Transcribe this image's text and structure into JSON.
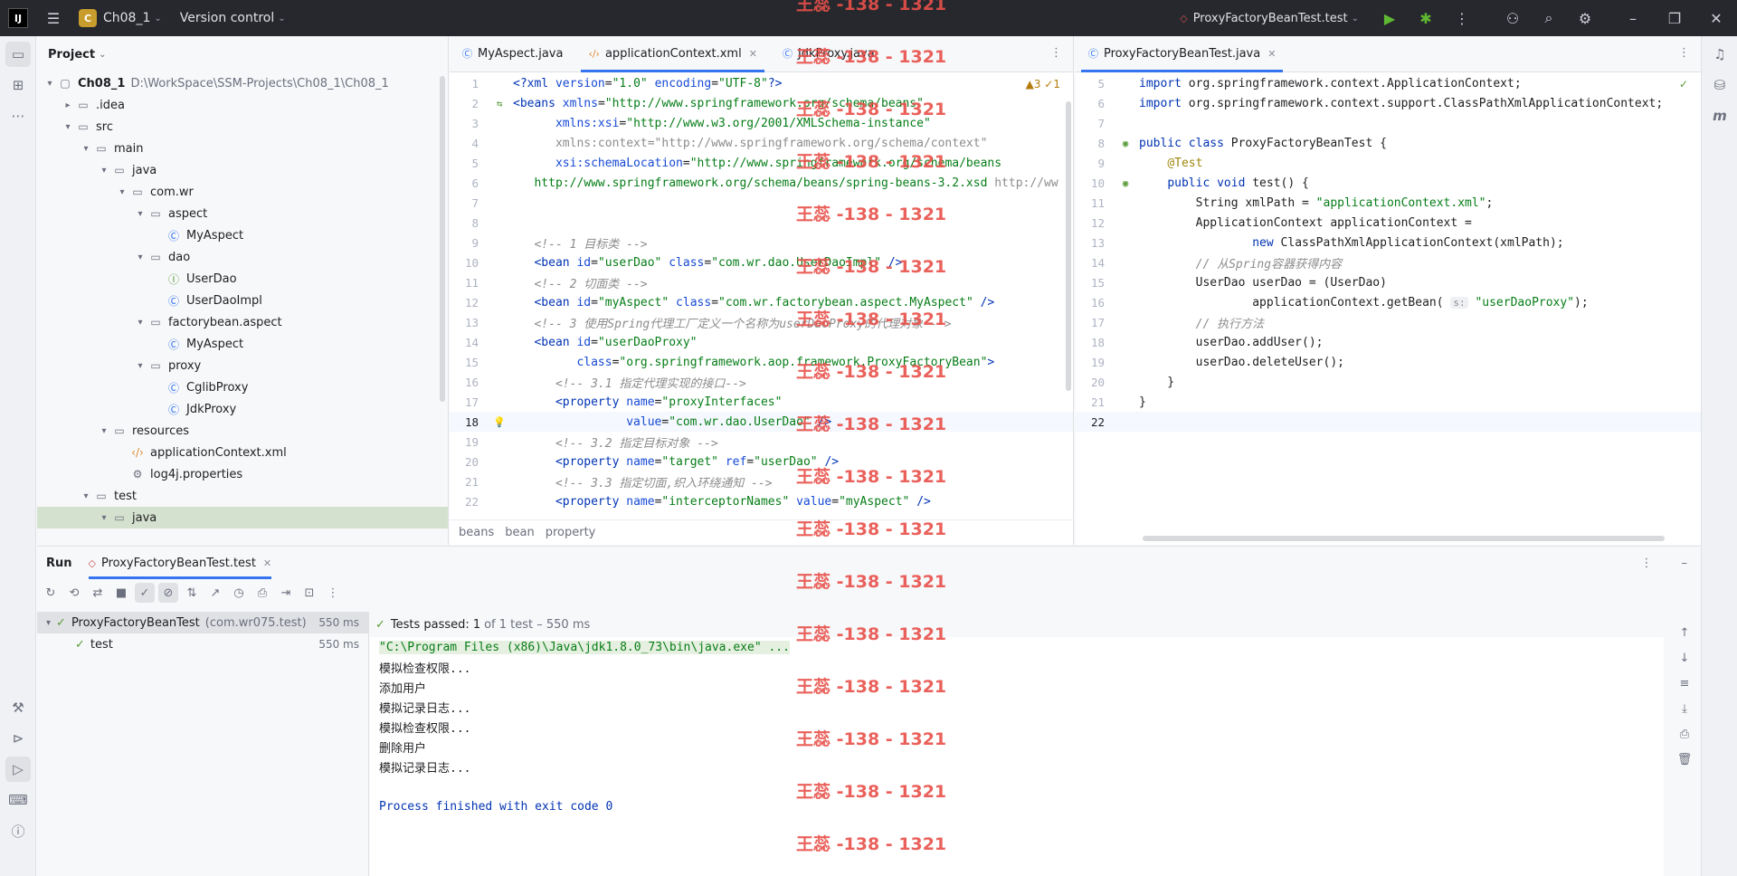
{
  "titlebar": {
    "project_badge": "C",
    "project_name": "Ch08_1",
    "vcs": "Version control",
    "run_config": "ProxyFactoryBeanTest.test"
  },
  "project_panel": {
    "title": "Project",
    "tree": [
      {
        "label": "Ch08_1",
        "path": "D:\\WorkSpace\\SSM-Projects\\Ch08_1\\Ch08_1",
        "depth": 0,
        "arrow": "▾",
        "icon": "▢"
      },
      {
        "label": ".idea",
        "depth": 1,
        "arrow": "▸",
        "icon": "▭"
      },
      {
        "label": "src",
        "depth": 1,
        "arrow": "▾",
        "icon": "▭"
      },
      {
        "label": "main",
        "depth": 2,
        "arrow": "▾",
        "icon": "▭"
      },
      {
        "label": "java",
        "depth": 3,
        "arrow": "▾",
        "icon": "▭"
      },
      {
        "label": "com.wr",
        "depth": 4,
        "arrow": "▾",
        "icon": "▭"
      },
      {
        "label": "aspect",
        "depth": 5,
        "arrow": "▾",
        "icon": "▭"
      },
      {
        "label": "MyAspect",
        "depth": 6,
        "arrow": "",
        "icon": "Ⓒ"
      },
      {
        "label": "dao",
        "depth": 5,
        "arrow": "▾",
        "icon": "▭"
      },
      {
        "label": "UserDao",
        "depth": 6,
        "arrow": "",
        "icon": "Ⓘ"
      },
      {
        "label": "UserDaoImpl",
        "depth": 6,
        "arrow": "",
        "icon": "Ⓒ"
      },
      {
        "label": "factorybean.aspect",
        "depth": 5,
        "arrow": "▾",
        "icon": "▭"
      },
      {
        "label": "MyAspect",
        "depth": 6,
        "arrow": "",
        "icon": "Ⓒ"
      },
      {
        "label": "proxy",
        "depth": 5,
        "arrow": "▾",
        "icon": "▭"
      },
      {
        "label": "CglibProxy",
        "depth": 6,
        "arrow": "",
        "icon": "Ⓒ"
      },
      {
        "label": "JdkProxy",
        "depth": 6,
        "arrow": "",
        "icon": "Ⓒ"
      },
      {
        "label": "resources",
        "depth": 3,
        "arrow": "▾",
        "icon": "▭"
      },
      {
        "label": "applicationContext.xml",
        "depth": 4,
        "arrow": "",
        "icon": "‹/›"
      },
      {
        "label": "log4j.properties",
        "depth": 4,
        "arrow": "",
        "icon": "⚙"
      },
      {
        "label": "test",
        "depth": 2,
        "arrow": "▾",
        "icon": "▭"
      },
      {
        "label": "java",
        "depth": 3,
        "arrow": "▾",
        "icon": "▭",
        "selected": true
      }
    ]
  },
  "editor1": {
    "tabs": [
      {
        "label": "MyAspect.java",
        "active": false
      },
      {
        "label": "applicationContext.xml",
        "active": true
      },
      {
        "label": "JdkProxy.java",
        "active": false
      }
    ],
    "inspection": "▲3 ✓1",
    "lines": [
      {
        "n": "1",
        "html": "<span class='k-tag'>&lt;?xml</span> <span class='k-attr'>version</span>=<span class='k-val'>\"1.0\"</span> <span class='k-attr'>encoding</span>=<span class='k-val'>\"UTF-8\"</span><span class='k-tag'>?&gt;</span>"
      },
      {
        "n": "2",
        "html": "<span class='k-tag'>&lt;beans</span> <span class='k-attr'>xmlns</span>=<span class='k-val'>\"http://www.springframework.org/schema/beans\"</span>"
      },
      {
        "n": "3",
        "html": "      <span class='k-attr'>xmlns:xsi</span>=<span class='k-val'>\"http://www.w3.org/2001/XMLSchema-instance\"</span>"
      },
      {
        "n": "4",
        "html": "      <span style='color:#8c8c8c'>xmlns:context=\"http://www.springframework.org/schema/context\"</span>"
      },
      {
        "n": "5",
        "html": "      <span class='k-attr'>xsi:schemaLocation</span>=<span class='k-val'>\"http://www.springframework.org/schema/beans</span>"
      },
      {
        "n": "6",
        "html": "   <span class='k-val'>http://www.springframework.org/schema/beans/spring-beans-3.2.xsd</span> <span style='color:#8c8c8c'>http://ww</span>"
      },
      {
        "n": "7",
        "html": ""
      },
      {
        "n": "8",
        "html": ""
      },
      {
        "n": "9",
        "html": "   <span class='k-com'>&lt;!-- 1 目标类 --&gt;</span>"
      },
      {
        "n": "10",
        "html": "   <span class='k-tag'>&lt;bean</span> <span class='k-attr'>id</span>=<span class='k-val'>\"userDao\"</span> <span class='k-attr'>class</span>=<span class='k-val'>\"com.wr.dao.UserDaoImpl\"</span> <span class='k-tag'>/&gt;</span>"
      },
      {
        "n": "11",
        "html": "   <span class='k-com'>&lt;!-- 2 切面类 --&gt;</span>"
      },
      {
        "n": "12",
        "html": "   <span class='k-tag'>&lt;bean</span> <span class='k-attr'>id</span>=<span class='k-val'>\"myAspect\"</span> <span class='k-attr'>class</span>=<span class='k-val'>\"com.wr.factorybean.aspect.MyAspect\"</span> <span class='k-tag'>/&gt;</span>"
      },
      {
        "n": "13",
        "html": "   <span class='k-com'>&lt;!-- 3 使用Spring代理工厂定义一个名称为userDaoProxy的代理对象 --&gt;</span>"
      },
      {
        "n": "14",
        "html": "   <span class='k-tag'>&lt;bean</span> <span class='k-attr'>id</span>=<span class='k-val'>\"userDaoProxy\"</span>"
      },
      {
        "n": "15",
        "html": "         <span class='k-attr'>class</span>=<span class='k-val'>\"org.springframework.aop.framework.ProxyFactoryBean\"</span><span class='k-tag'>&gt;</span>"
      },
      {
        "n": "16",
        "html": "      <span class='k-com'>&lt;!-- 3.1 指定代理实现的接口--&gt;</span>"
      },
      {
        "n": "17",
        "html": "      <span class='k-tag'>&lt;property</span> <span class='k-attr'>name</span>=<span class='k-val'>\"proxyInterfaces\"</span>"
      },
      {
        "n": "18",
        "html": "                <span class='k-attr'>value</span>=<span class='k-val'>\"com.wr.dao.UserDao\"</span> <span class='k-tag'>/&gt;</span>",
        "current": true
      },
      {
        "n": "19",
        "html": "      <span class='k-com'>&lt;!-- 3.2 指定目标对象 --&gt;</span>"
      },
      {
        "n": "20",
        "html": "      <span class='k-tag'>&lt;property</span> <span class='k-attr'>name</span>=<span class='k-val'>\"target\"</span> <span class='k-attr'>ref</span>=<span class='k-val'>\"userDao\"</span> <span class='k-tag'>/&gt;</span>"
      },
      {
        "n": "21",
        "html": "      <span class='k-com'>&lt;!-- 3.3 指定切面,织入环绕通知 --&gt;</span>"
      },
      {
        "n": "22",
        "html": "      <span class='k-tag'>&lt;property</span> <span class='k-attr'>name</span>=<span class='k-val'>\"interceptorNames\"</span> <span class='k-attr'>value</span>=<span class='k-val'>\"myAspect\"</span> <span class='k-tag'>/&gt;</span>"
      }
    ],
    "breadcrumb": [
      "beans",
      "bean",
      "property"
    ]
  },
  "editor2": {
    "tabs": [
      {
        "label": "ProxyFactoryBeanTest.java",
        "active": true
      }
    ],
    "lines": [
      {
        "n": "5",
        "html": "<span class='k-kw'>import</span> org.springframework.context.ApplicationContext;"
      },
      {
        "n": "6",
        "html": "<span class='k-kw'>import</span> org.springframework.context.support.ClassPathXmlApplicationContext;"
      },
      {
        "n": "7",
        "html": ""
      },
      {
        "n": "8",
        "html": "<span class='k-kw'>public class</span> ProxyFactoryBeanTest {"
      },
      {
        "n": "9",
        "html": "    <span class='k-ann'>@Test</span>"
      },
      {
        "n": "10",
        "html": "    <span class='k-kw'>public void</span> test() {"
      },
      {
        "n": "11",
        "html": "        String xmlPath = <span class='k-str'>\"applicationContext.xml\"</span>;"
      },
      {
        "n": "12",
        "html": "        ApplicationContext applicationContext ="
      },
      {
        "n": "13",
        "html": "                <span class='k-kw'>new</span> ClassPathXmlApplicationContext(xmlPath);"
      },
      {
        "n": "14",
        "html": "        <span class='k-com'>// 从Spring容器获得内容</span>"
      },
      {
        "n": "15",
        "html": "        UserDao userDao = (UserDao)"
      },
      {
        "n": "16",
        "html": "                applicationContext.getBean( <span class='k-hint'>s:</span> <span class='k-str'>\"userDaoProxy\"</span>);"
      },
      {
        "n": "17",
        "html": "        <span class='k-com'>// 执行方法</span>"
      },
      {
        "n": "18",
        "html": "        userDao.addUser();"
      },
      {
        "n": "19",
        "html": "        userDao.deleteUser();"
      },
      {
        "n": "20",
        "html": "    }"
      },
      {
        "n": "21",
        "html": "}"
      },
      {
        "n": "22",
        "html": "",
        "current": true
      }
    ]
  },
  "run": {
    "tab_run": "Run",
    "tab_config": "ProxyFactoryBeanTest.test",
    "tests": [
      {
        "name": "ProxyFactoryBeanTest",
        "pkg": "(com.wr075.test)",
        "dur": "550 ms"
      },
      {
        "name": "test",
        "pkg": "",
        "dur": "550 ms"
      }
    ],
    "status_prefix": "Tests passed:",
    "status_count": "1",
    "status_suffix": "of 1 test – 550 ms",
    "console": [
      {
        "text": "\"C:\\Program Files (x86)\\Java\\jdk1.8.0_73\\bin\\java.exe\" ...",
        "kind": "cmd"
      },
      {
        "text": "模拟检查权限...",
        "kind": "out"
      },
      {
        "text": "添加用户",
        "kind": "out"
      },
      {
        "text": "模拟记录日志...",
        "kind": "out"
      },
      {
        "text": "模拟检查权限...",
        "kind": "out"
      },
      {
        "text": "删除用户",
        "kind": "out"
      },
      {
        "text": "模拟记录日志...",
        "kind": "out"
      },
      {
        "text": "",
        "kind": "out"
      },
      {
        "text": "Process finished with exit code 0",
        "kind": "done"
      }
    ]
  },
  "watermark": "王蕊 -138 - 1321"
}
